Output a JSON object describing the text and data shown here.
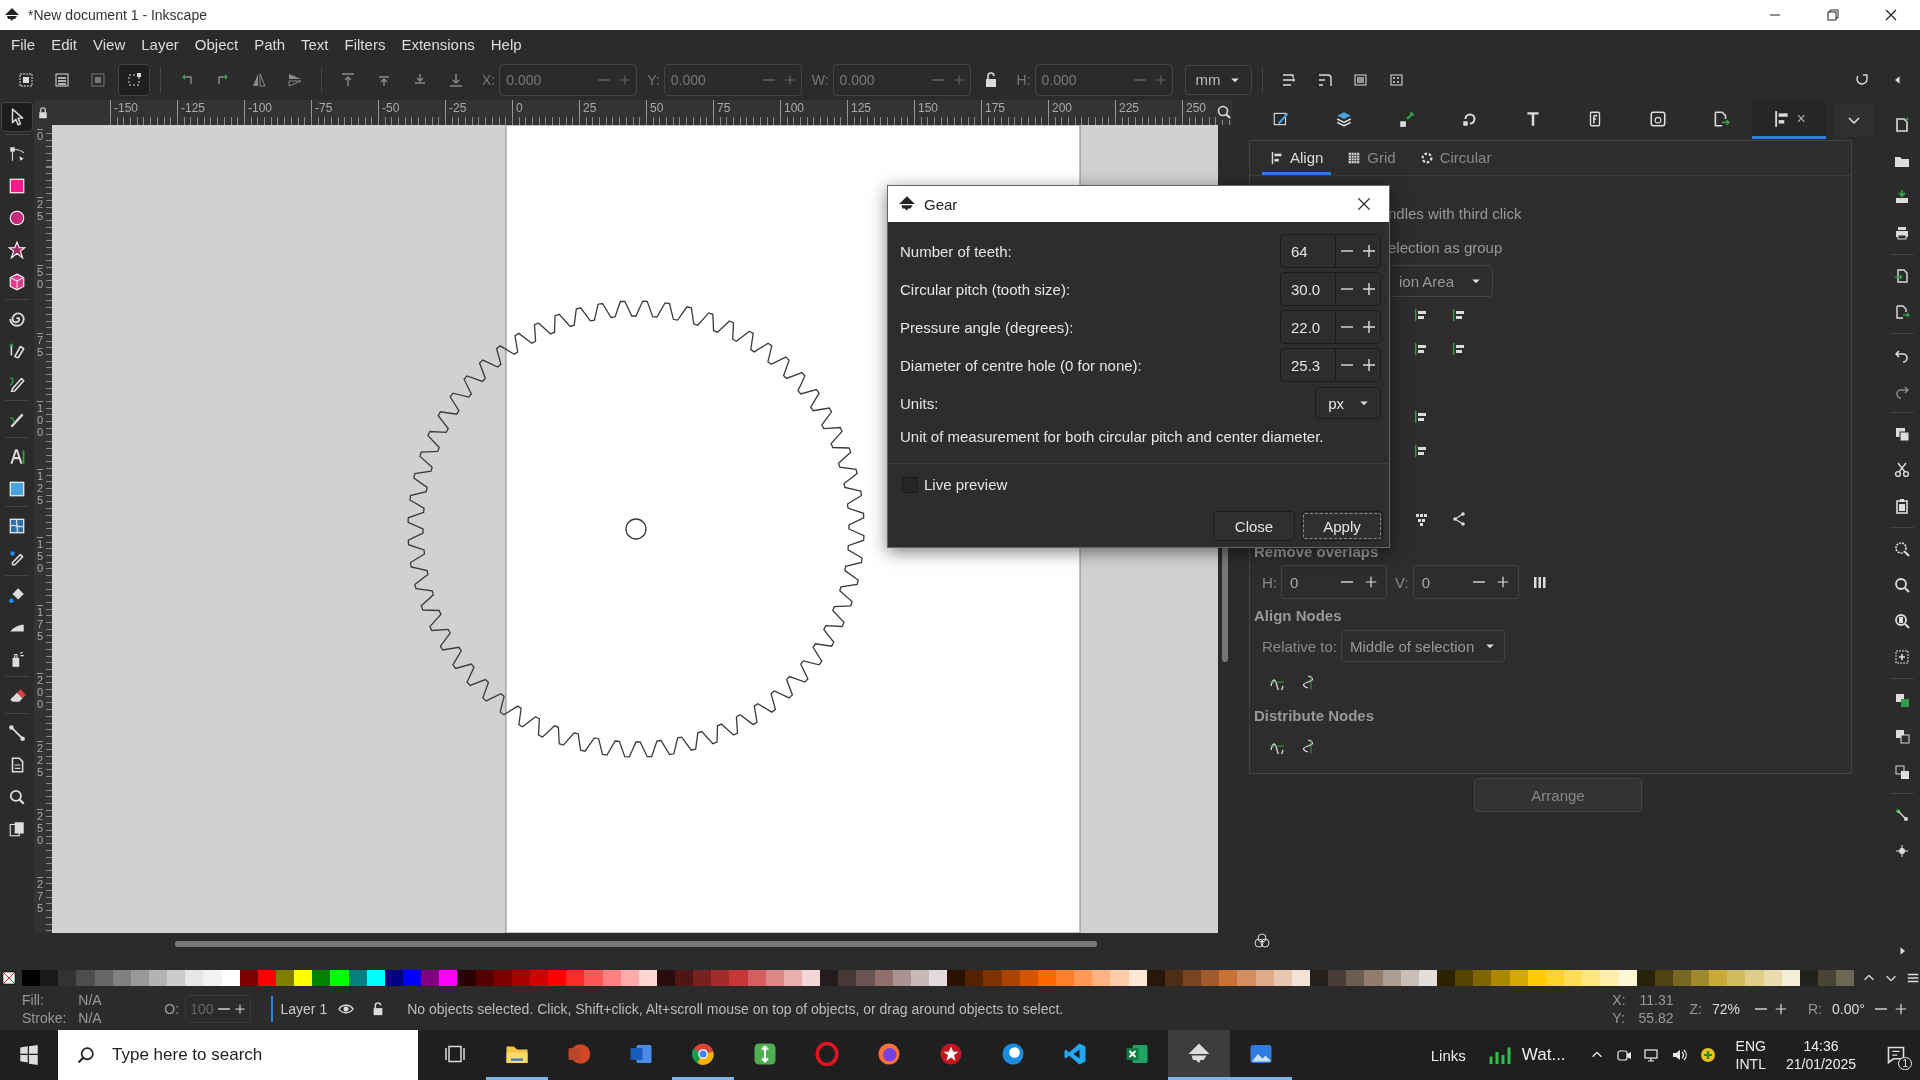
{
  "window": {
    "title": "*New document 1 - Inkscape"
  },
  "menu": [
    "File",
    "Edit",
    "View",
    "Layer",
    "Object",
    "Path",
    "Text",
    "Filters",
    "Extensions",
    "Help"
  ],
  "toolbar": {
    "fields": [
      {
        "label": "X:",
        "value": "0.000",
        "disabled": true
      },
      {
        "label": "Y:",
        "value": "0.000",
        "disabled": true
      },
      {
        "label": "W:",
        "value": "0.000",
        "disabled": true
      },
      {
        "label": "H:",
        "value": "0.000",
        "disabled": true
      }
    ],
    "unit": "mm"
  },
  "ruler": {
    "horizontal": [
      "-150",
      "-125",
      "-100",
      "-75",
      "-50",
      "-25",
      "0",
      "25",
      "50",
      "75",
      "100",
      "125",
      "150",
      "175",
      "200",
      "225",
      "250"
    ],
    "vertical": [
      "0",
      "25",
      "50",
      "75",
      "100",
      "125",
      "150",
      "175",
      "200",
      "225",
      "250",
      "275"
    ]
  },
  "tools": [
    {
      "selected": true
    },
    {
      "selected": false
    },
    {
      "selected": false
    },
    {
      "selected": false
    },
    {
      "selected": false
    },
    {
      "selected": false
    },
    {
      "selected": false
    },
    {
      "selected": false
    },
    {
      "selected": false
    },
    {
      "selected": false
    },
    {
      "selected": false
    },
    {
      "selected": false
    },
    {
      "selected": false
    },
    {
      "selected": false
    },
    {
      "selected": false
    },
    {
      "selected": false
    },
    {
      "selected": false
    },
    {
      "selected": false
    },
    {
      "selected": false
    },
    {
      "selected": false
    },
    {
      "selected": false
    },
    {
      "selected": false
    }
  ],
  "dialog": {
    "title": "Gear",
    "fields": [
      {
        "label": "Number of teeth:",
        "value": "64"
      },
      {
        "label": "Circular pitch (tooth size):",
        "value": "30.0"
      },
      {
        "label": "Pressure angle (degrees):",
        "value": "22.0"
      },
      {
        "label": "Diameter of centre hole (0 for none):",
        "value": "25.3"
      }
    ],
    "units": {
      "label": "Units:",
      "value": "px"
    },
    "hint": "Unit of measurement for both circular pitch and center diameter.",
    "live_preview": {
      "label": "Live preview",
      "checked": false
    },
    "buttons": [
      "Close",
      "Apply"
    ]
  },
  "dock": {
    "tabs": [
      {
        "selected": false
      },
      {
        "selected": false
      },
      {
        "selected": false
      },
      {
        "selected": false
      },
      {
        "selected": false
      },
      {
        "selected": false
      },
      {
        "selected": false
      },
      {
        "selected": false
      },
      {
        "selected": true
      }
    ],
    "close_glyph": "×",
    "subtabs": [
      {
        "label": "Align",
        "selected": true
      },
      {
        "label": "Grid",
        "selected": false
      },
      {
        "label": "Circular",
        "selected": false
      }
    ],
    "partial_lines": [
      "ndles with third click",
      "election as group"
    ],
    "partial_dropdown": "ion Area",
    "remove_overlaps": {
      "title": "Remove overlaps",
      "h_label": "H:",
      "h_value": "0",
      "v_label": "V:",
      "v_value": "0"
    },
    "align_nodes": {
      "title": "Align Nodes",
      "relative_label": "Relative to:",
      "relative_value": "Middle of selection"
    },
    "distribute_nodes": {
      "title": "Distribute Nodes"
    },
    "arrange_button": "Arrange"
  },
  "palette": [
    {
      "color": "#000000"
    },
    {
      "color": "#1a1a1a"
    },
    {
      "color": "#333333"
    },
    {
      "color": "#4d4d4d"
    },
    {
      "color": "#666666"
    },
    {
      "color": "#808080"
    },
    {
      "color": "#999999"
    },
    {
      "color": "#b3b3b3"
    },
    {
      "color": "#cccccc"
    },
    {
      "color": "#e6e6e6"
    },
    {
      "color": "#f2f2f2"
    },
    {
      "color": "#ffffff"
    },
    {
      "color": "#800000"
    },
    {
      "color": "#ff0000"
    },
    {
      "color": "#808000"
    },
    {
      "color": "#ffff00"
    },
    {
      "color": "#008000"
    },
    {
      "color": "#00ff00"
    },
    {
      "color": "#008080"
    },
    {
      "color": "#00ffff"
    },
    {
      "color": "#000080"
    },
    {
      "color": "#0000ff"
    },
    {
      "color": "#800080"
    },
    {
      "color": "#ff00ff"
    },
    {
      "color": "#2b0000"
    },
    {
      "color": "#550000"
    },
    {
      "color": "#800001"
    },
    {
      "color": "#aa0000"
    },
    {
      "color": "#d40000"
    },
    {
      "color": "#ff0001"
    },
    {
      "color": "#ff2a2a"
    },
    {
      "color": "#ff5555"
    },
    {
      "color": "#ff8080"
    },
    {
      "color": "#ffaaaa"
    },
    {
      "color": "#ffd5d5"
    },
    {
      "color": "#280b0b"
    },
    {
      "color": "#501616"
    },
    {
      "color": "#782121"
    },
    {
      "color": "#a02c2c"
    },
    {
      "color": "#c83737"
    },
    {
      "color": "#d35f5f"
    },
    {
      "color": "#de8787"
    },
    {
      "color": "#e9afaf"
    },
    {
      "color": "#f4d7d7"
    },
    {
      "color": "#241c1c"
    },
    {
      "color": "#483737"
    },
    {
      "color": "#6c5353"
    },
    {
      "color": "#916f6f"
    },
    {
      "color": "#ac9393"
    },
    {
      "color": "#c8b7b7"
    },
    {
      "color": "#e3dbdb"
    },
    {
      "color": "#2b1100"
    },
    {
      "color": "#552200"
    },
    {
      "color": "#803300"
    },
    {
      "color": "#aa4400"
    },
    {
      "color": "#d45500"
    },
    {
      "color": "#ff6600"
    },
    {
      "color": "#ff7f2a"
    },
    {
      "color": "#ff9955"
    },
    {
      "color": "#ffb380"
    },
    {
      "color": "#ffccaa"
    },
    {
      "color": "#ffe6d5"
    },
    {
      "color": "#28170b"
    },
    {
      "color": "#502d16"
    },
    {
      "color": "#784421"
    },
    {
      "color": "#a05a2c"
    },
    {
      "color": "#c87137"
    },
    {
      "color": "#d38d5f"
    },
    {
      "color": "#deaa87"
    },
    {
      "color": "#e9c6af"
    },
    {
      "color": "#f4e3d7"
    },
    {
      "color": "#241f1c"
    },
    {
      "color": "#483e37"
    },
    {
      "color": "#6c5d53"
    },
    {
      "color": "#917c6f"
    },
    {
      "color": "#ac9d93"
    },
    {
      "color": "#c8beb7"
    },
    {
      "color": "#e3dedb"
    },
    {
      "color": "#2b2200"
    },
    {
      "color": "#554400"
    },
    {
      "color": "#806600"
    },
    {
      "color": "#aa8800"
    },
    {
      "color": "#d4aa00"
    },
    {
      "color": "#ffcc00"
    },
    {
      "color": "#ffd42a"
    },
    {
      "color": "#ffdd55"
    },
    {
      "color": "#ffe680"
    },
    {
      "color": "#ffeeaa"
    },
    {
      "color": "#fff6d5"
    },
    {
      "color": "#28220b"
    },
    {
      "color": "#504416"
    },
    {
      "color": "#786721"
    },
    {
      "color": "#a0892c"
    },
    {
      "color": "#c8ab37"
    },
    {
      "color": "#d3bc5f"
    },
    {
      "color": "#decd87"
    },
    {
      "color": "#e9ddaf"
    },
    {
      "color": "#f4eed7"
    },
    {
      "color": "#24221c"
    },
    {
      "color": "#484537"
    },
    {
      "color": "#6c6753"
    }
  ],
  "status_bar": {
    "fill_label": "Fill:",
    "fill_value": "N/A",
    "stroke_label": "Stroke:",
    "stroke_value": "N/A",
    "opacity_label": "O:",
    "opacity_value": "100",
    "layer": "Layer 1",
    "message": "No objects selected. Click, Shift+click, Alt+scroll mouse on top of objects, or drag around objects to select.",
    "x_label": "X:",
    "x_value": "11.31",
    "y_label": "Y:",
    "y_value": "55.82",
    "zoom_label": "Z:",
    "zoom_value": "72%",
    "rotate_label": "R:",
    "rotate_value": "0.00°"
  },
  "taskbar": {
    "search_placeholder": "Type here to search",
    "apps": [
      {
        "running": false,
        "selected": false
      },
      {
        "running": true,
        "selected": false
      },
      {
        "running": false,
        "selected": false
      },
      {
        "running": false,
        "selected": false
      },
      {
        "running": true,
        "selected": false
      },
      {
        "running": false,
        "selected": false
      },
      {
        "running": false,
        "selected": false
      },
      {
        "running": false,
        "selected": false
      },
      {
        "running": false,
        "selected": false
      },
      {
        "running": false,
        "selected": false
      },
      {
        "running": false,
        "selected": false
      },
      {
        "running": false,
        "selected": false
      },
      {
        "running": true,
        "selected": true
      },
      {
        "running": true,
        "selected": false
      }
    ],
    "links": "Links",
    "weather": "Wat...",
    "language": "ENG",
    "layout": "INTL",
    "time": "14:36",
    "date": "21/01/2025",
    "notifications": "1"
  }
}
